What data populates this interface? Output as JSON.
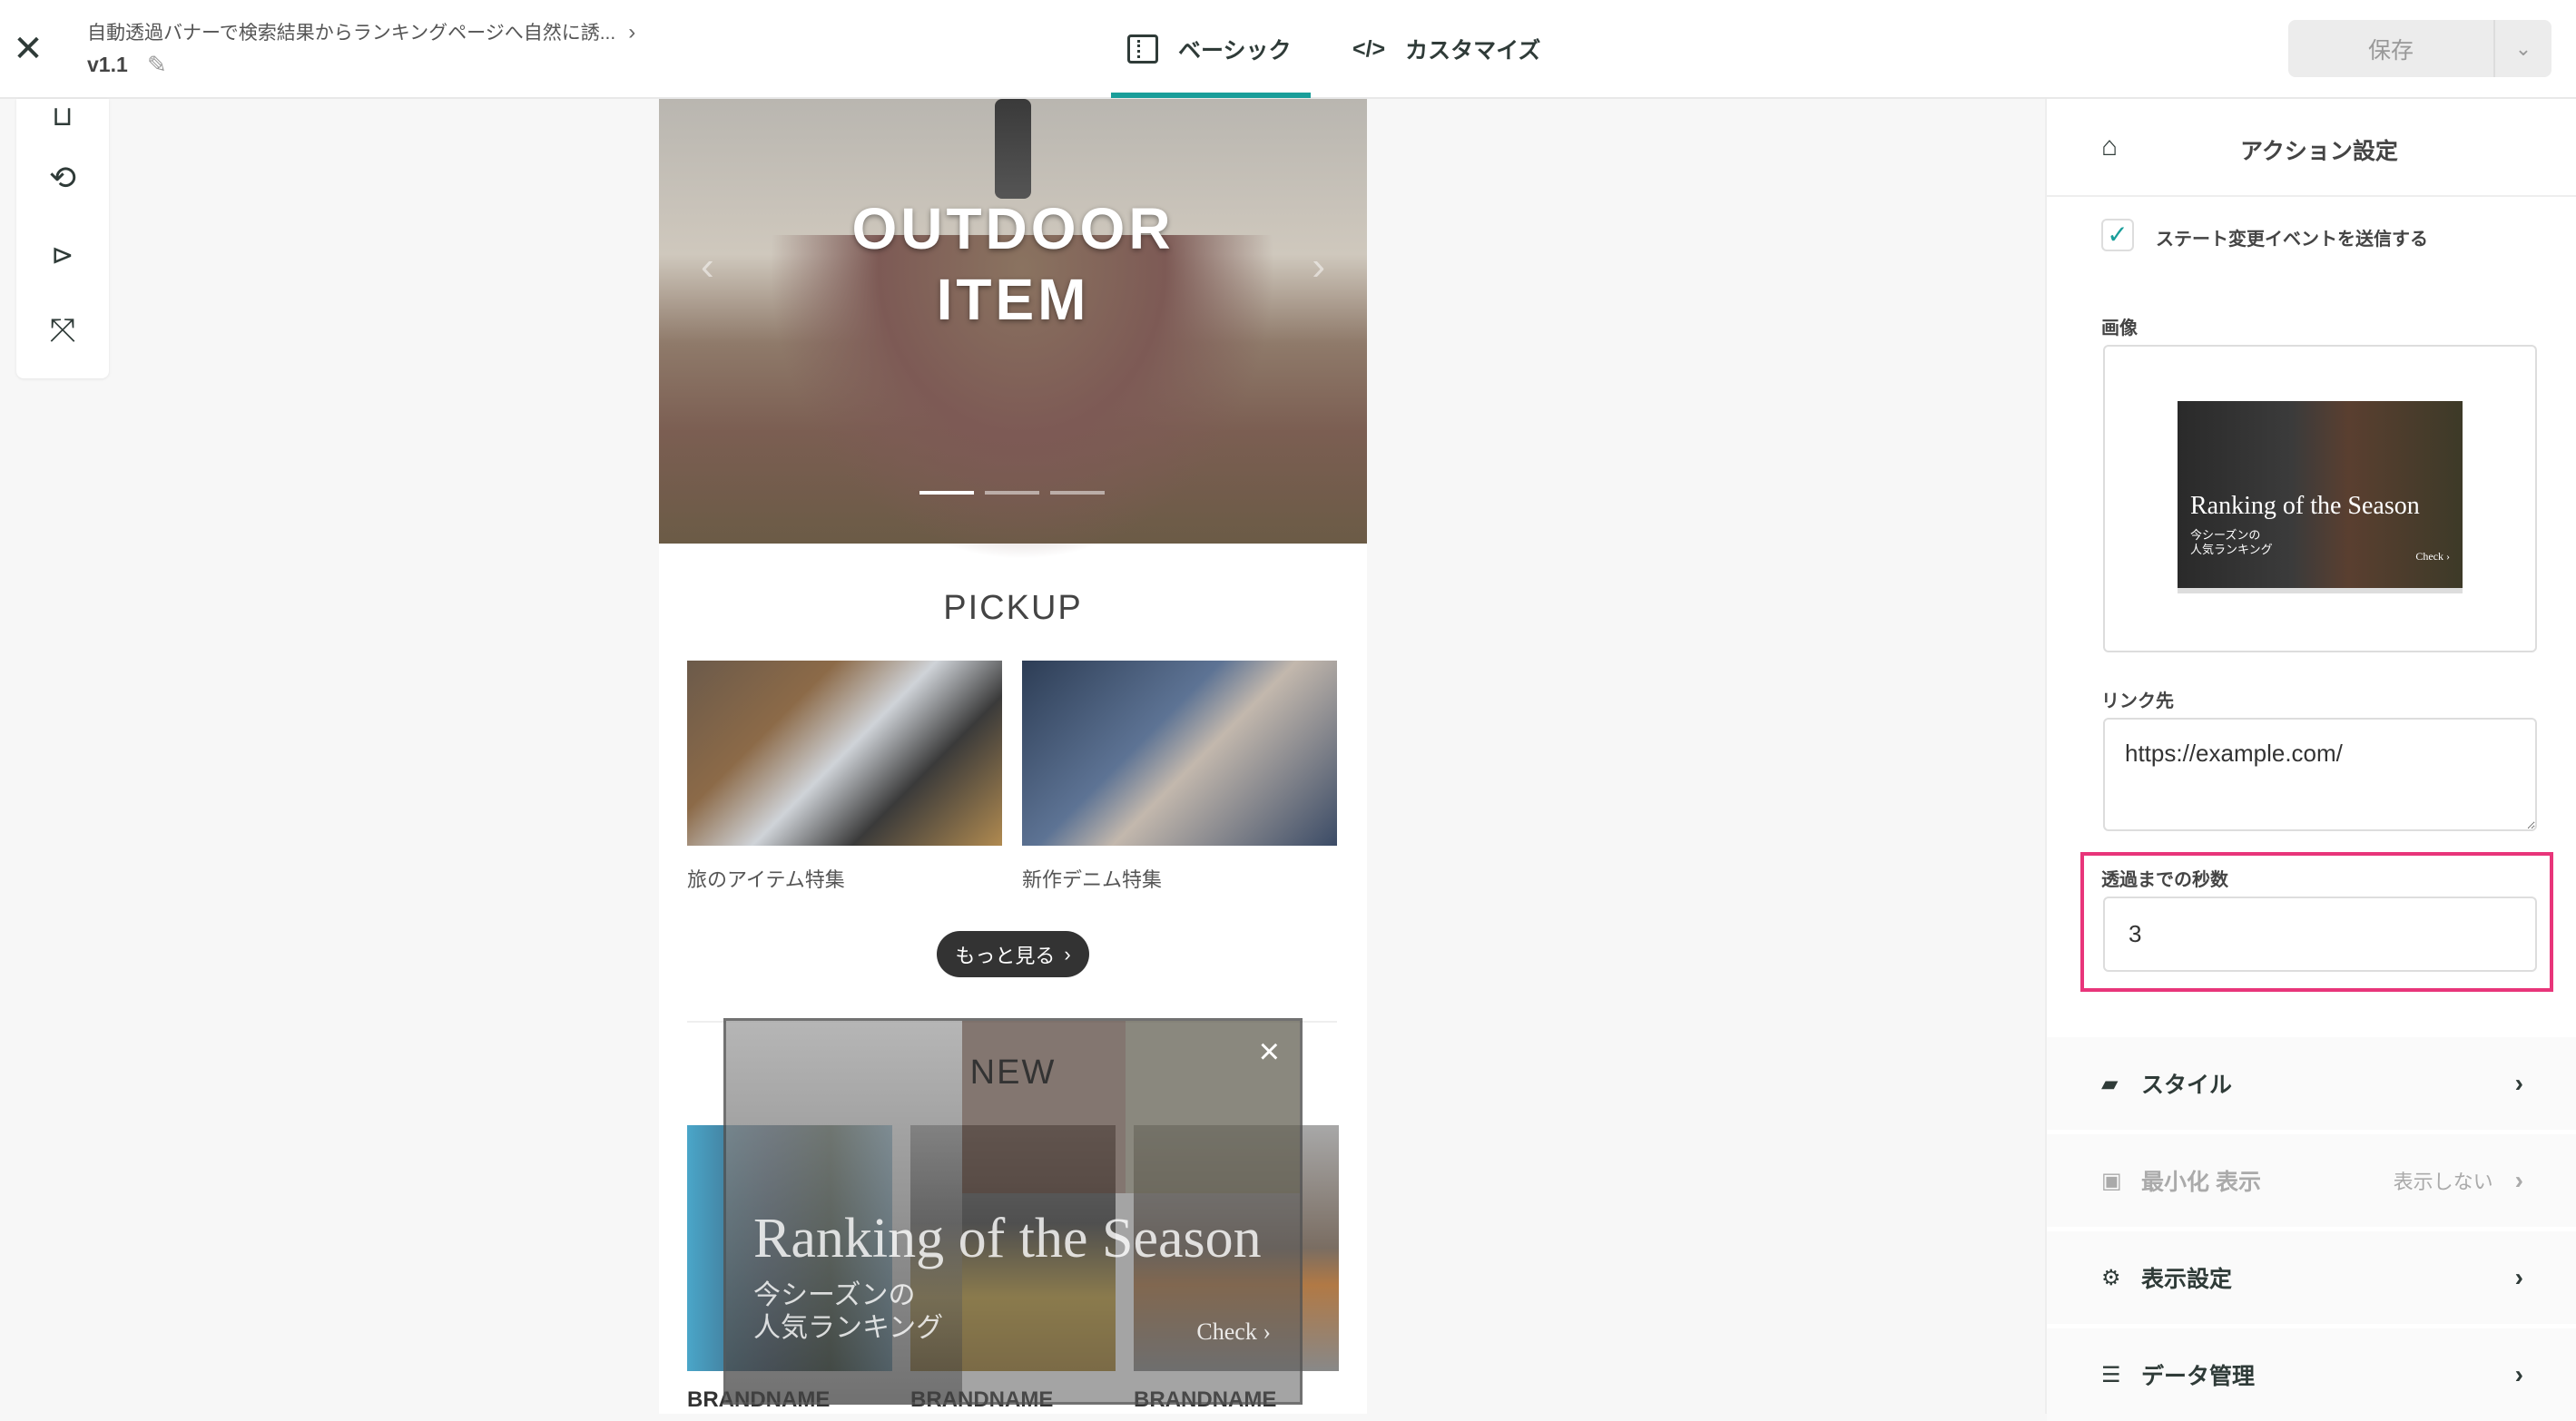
{
  "header": {
    "title": "自動透過バナーで検索結果からランキングページへ自然に誘...",
    "version": "v1.1",
    "tabs": [
      {
        "label": "ベーシック",
        "icon": "panel-icon",
        "active": true
      },
      {
        "label": "カスタマイズ",
        "icon": "code-icon"
      }
    ],
    "save_label": "保存"
  },
  "toolbar": {
    "icons": [
      "device-icon",
      "rotate-icon",
      "play-icon",
      "expand-icon"
    ]
  },
  "preview": {
    "hero": {
      "line1": "OUTDOOR",
      "line2": "ITEM",
      "slides": 3,
      "active_slide": 1
    },
    "pickup": {
      "title": "PICKUP",
      "items": [
        {
          "caption": "旅のアイテム特集"
        },
        {
          "caption": "新作デニム特集"
        }
      ],
      "more_label": "もっと見る"
    },
    "new": {
      "title": "NEW",
      "brands": [
        "BRANDNAME",
        "BRANDNAME",
        "BRANDNAME"
      ]
    },
    "banner": {
      "title": "Ranking of the Season",
      "sub1": "今シーズンの",
      "sub2": "人気ランキング",
      "check": "Check ›",
      "close": "×"
    }
  },
  "panel": {
    "title": "アクション設定",
    "checkbox_label": "ステート変更イベントを送信する",
    "checkbox_checked": true,
    "image_label": "画像",
    "thumb": {
      "title": "Ranking of the Season",
      "sub1": "今シーズンの",
      "sub2": "人気ランキング",
      "check": "Check ›"
    },
    "link_label": "リンク先",
    "link_value": "https://example.com/",
    "seconds_label": "透過までの秒数",
    "seconds_value": "3",
    "sections": [
      {
        "label": "スタイル",
        "icon": "folder-icon"
      },
      {
        "label": "最小化 表示",
        "value": "表示しない",
        "icon": "minimize-icon",
        "disabled": true
      },
      {
        "label": "表示設定",
        "icon": "gear-icon"
      },
      {
        "label": "データ管理",
        "icon": "database-icon"
      }
    ]
  },
  "colors": {
    "accent": "#1a9e9a",
    "highlight": "#e8357a",
    "text": "#2f3b38"
  }
}
